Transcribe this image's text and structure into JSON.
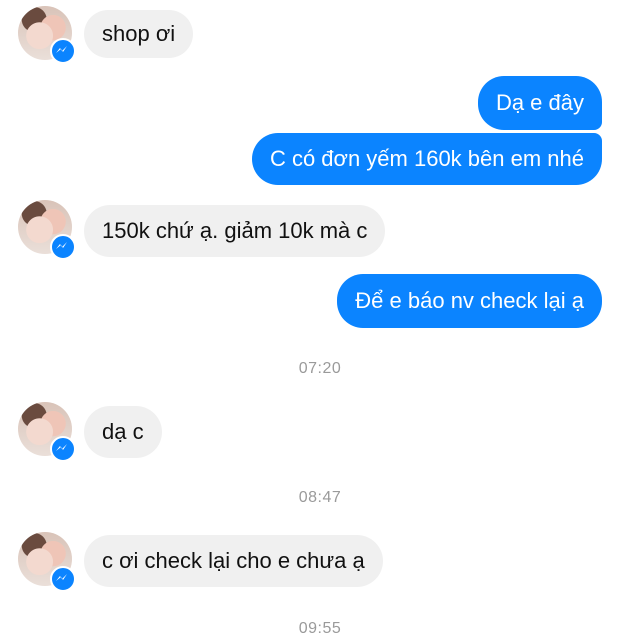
{
  "messages": {
    "m1": {
      "text": "shop ơi",
      "sender": "customer"
    },
    "m2": {
      "text": "Dạ e đây",
      "sender": "shop"
    },
    "m3": {
      "text": "C có đơn yếm 160k bên em nhé",
      "sender": "shop"
    },
    "m4": {
      "text": "150k chứ ạ.  giảm 10k mà c",
      "sender": "customer"
    },
    "m5": {
      "text": "Để e báo nv check lại ạ",
      "sender": "shop"
    },
    "t1": {
      "text": "07:20"
    },
    "m6": {
      "text": "dạ c",
      "sender": "customer"
    },
    "t2": {
      "text": "08:47"
    },
    "m7": {
      "text": "c ơi check lại cho e chưa ạ",
      "sender": "customer"
    },
    "t3": {
      "text": "09:55"
    }
  },
  "colors": {
    "outgoing_bubble": "#0b84ff",
    "incoming_bubble": "#f0f0f0",
    "timestamp": "#9a9a9a",
    "messenger_badge": "#0b84ff"
  },
  "icons": {
    "avatar": "contact-avatar-photo",
    "badge": "messenger-icon"
  }
}
